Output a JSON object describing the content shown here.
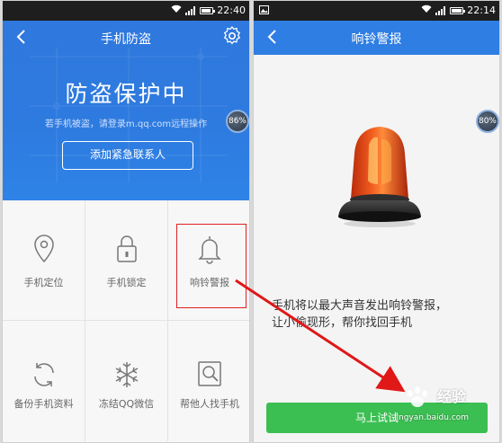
{
  "left_screen": {
    "status_time": "22:40",
    "title": "手机防盗",
    "hero_title": "防盗保护中",
    "hero_subtitle": "若手机被盗，请登录m.qq.com远程操作",
    "add_contact_label": "添加紧急联系人",
    "badge": "86%",
    "features": [
      {
        "label": "手机定位",
        "icon": "location-pin-icon"
      },
      {
        "label": "手机锁定",
        "icon": "padlock-icon"
      },
      {
        "label": "响铃警报",
        "icon": "bell-icon"
      },
      {
        "label": "备份手机资料",
        "icon": "sync-icon"
      },
      {
        "label": "冻结QQ微信",
        "icon": "snowflake-icon"
      },
      {
        "label": "帮他人找手机",
        "icon": "magnifier-icon"
      }
    ]
  },
  "right_screen": {
    "status_time": "22:14",
    "title": "响铃警报",
    "badge": "80%",
    "description_line1": "手机将以最大声音发出响铃警报，",
    "description_line2": "让小偷现形，帮你找回手机",
    "try_button_label": "马上试试"
  },
  "watermark": {
    "brand": "经验",
    "url": "jingyan.baidu.com"
  },
  "colors": {
    "primary_blue": "#2e7be0",
    "highlight_red": "#e02020",
    "try_green": "#3bbf52"
  }
}
